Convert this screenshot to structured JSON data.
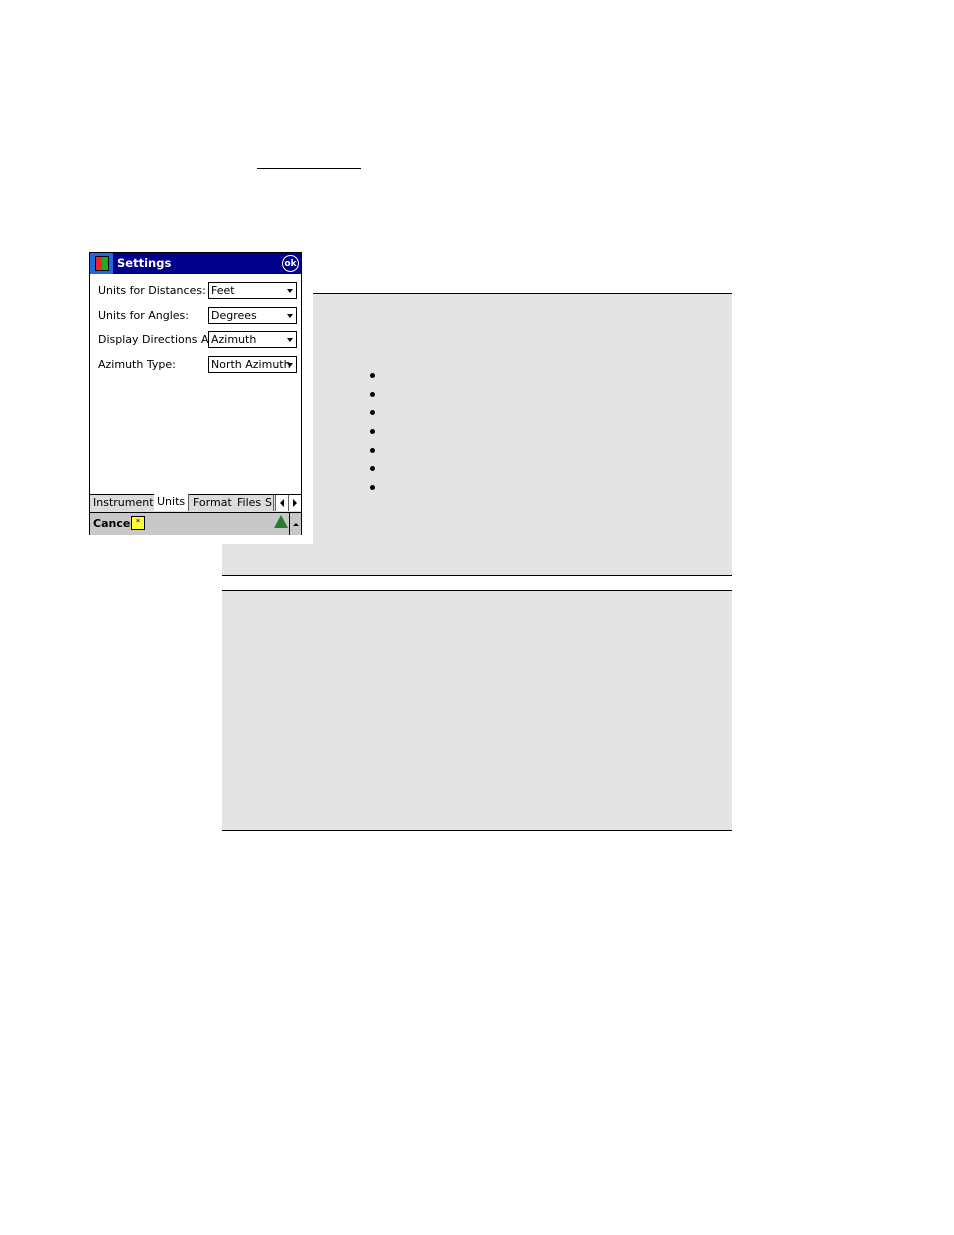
{
  "document": {
    "heading_rule": true,
    "info_box_1": {
      "bullet_count": 7
    },
    "info_box_2": {}
  },
  "device": {
    "title": "Settings",
    "ok_label": "ok",
    "form": [
      {
        "label": "Units for Distances:",
        "value": "Feet"
      },
      {
        "label": "Units for Angles:",
        "value": "Degrees"
      },
      {
        "label": "Display Directions As:",
        "value": "Azimuth"
      },
      {
        "label": "Azimuth Type:",
        "value": "North Azimuth"
      }
    ],
    "tabs": [
      {
        "label": "Instrument",
        "active": false
      },
      {
        "label": "Units",
        "active": true
      },
      {
        "label": "Format",
        "active": false
      },
      {
        "label": "Files",
        "active": false
      },
      {
        "label": "S",
        "active": false
      }
    ],
    "cancel_label": "Cancel",
    "sip_glyph": "*",
    "colors": {
      "titlebar": "#00008b",
      "start": "#1e6ad8",
      "background": "#e4e4e4"
    }
  }
}
